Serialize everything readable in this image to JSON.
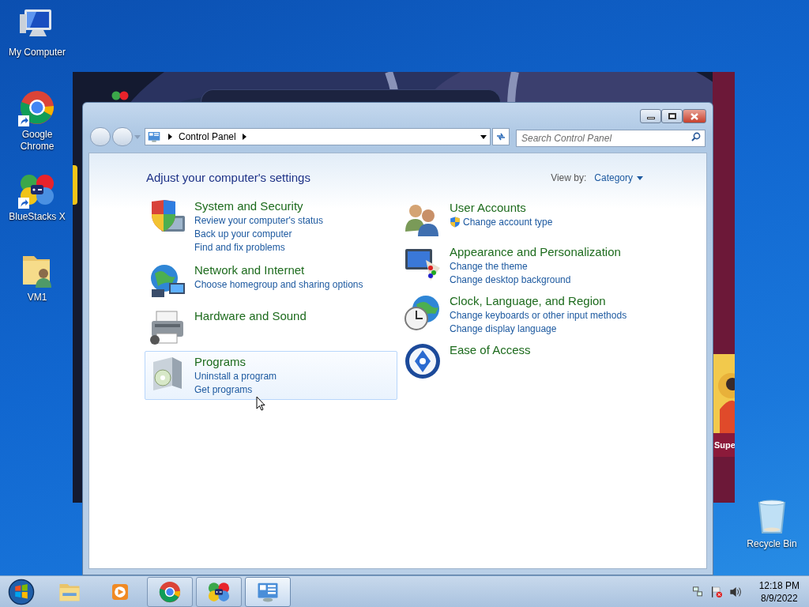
{
  "desktop_icons": [
    {
      "kind": "computer",
      "label": "My Computer",
      "shortcut": false
    },
    {
      "kind": "chrome",
      "label": "Google Chrome",
      "shortcut": true
    },
    {
      "kind": "bluestacks",
      "label": "BlueStacks X",
      "shortcut": true
    },
    {
      "kind": "folder",
      "label": "VM1",
      "shortcut": false
    },
    {
      "kind": "recycle",
      "label": "Recycle Bin",
      "shortcut": false
    }
  ],
  "background_app": {
    "card_label": "Supe"
  },
  "window": {
    "address": [
      "Control Panel"
    ],
    "search": {
      "placeholder": "Search Control Panel"
    },
    "heading": "Adjust your computer's settings",
    "view_by": {
      "label": "View by:",
      "value": "Category"
    },
    "columns": [
      [
        {
          "kind": "security",
          "title": "System and Security",
          "hovered": false,
          "links": [
            {
              "text": "Review your computer's status",
              "shield": false
            },
            {
              "text": "Back up your computer",
              "shield": false
            },
            {
              "text": "Find and fix problems",
              "shield": false
            }
          ]
        },
        {
          "kind": "network",
          "title": "Network and Internet",
          "hovered": false,
          "links": [
            {
              "text": "Choose homegroup and sharing options",
              "shield": false
            }
          ]
        },
        {
          "kind": "hardware",
          "title": "Hardware and Sound",
          "hovered": false
        },
        {
          "kind": "programs",
          "title": "Programs",
          "hovered": true,
          "links": [
            {
              "text": "Uninstall a program",
              "shield": false
            },
            {
              "text": "Get programs",
              "shield": false
            }
          ]
        }
      ],
      [
        {
          "kind": "users",
          "title": "User Accounts",
          "hovered": false,
          "links": [
            {
              "text": "Change account type",
              "shield": true
            }
          ]
        },
        {
          "kind": "appearance",
          "title": "Appearance and Personalization",
          "hovered": false,
          "links": [
            {
              "text": "Change the theme",
              "shield": false
            },
            {
              "text": "Change desktop background",
              "shield": false
            }
          ]
        },
        {
          "kind": "clock",
          "title": "Clock, Language, and Region",
          "hovered": false,
          "links": [
            {
              "text": "Change keyboards or other input methods",
              "shield": false
            },
            {
              "text": "Change display language",
              "shield": false
            }
          ]
        },
        {
          "kind": "access",
          "title": "Ease of Access",
          "hovered": false
        }
      ]
    ]
  },
  "taskbar": {
    "items": [
      {
        "kind": "explorer",
        "running": false,
        "selected": false
      },
      {
        "kind": "media",
        "running": false,
        "selected": false
      },
      {
        "kind": "chrome",
        "running": true,
        "selected": false
      },
      {
        "kind": "bluestacks",
        "running": true,
        "selected": false
      },
      {
        "kind": "controlpanel",
        "running": true,
        "selected": true
      }
    ],
    "time": "12:18 PM",
    "date": "8/9/2022"
  }
}
